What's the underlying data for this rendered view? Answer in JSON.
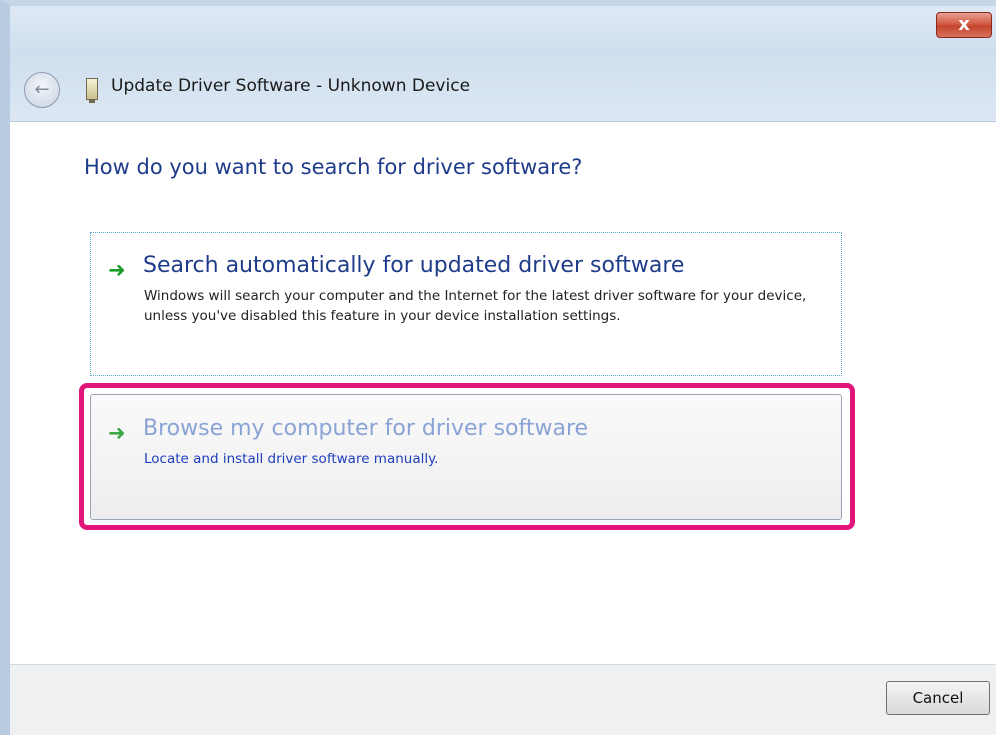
{
  "window": {
    "title": "Update Driver Software - Unknown Device",
    "close_label": "x"
  },
  "main": {
    "question": "How do you want to search for driver software?",
    "options": [
      {
        "title": "Search automatically for updated driver software",
        "description": "Windows will search your computer and the Internet for the latest driver software for your device, unless you've disabled this feature in your device installation settings."
      },
      {
        "title": "Browse my computer for driver software",
        "description": "Locate and install driver software manually."
      }
    ]
  },
  "footer": {
    "cancel_label": "Cancel"
  },
  "colors": {
    "highlight": "#e2157a",
    "heading": "#1f3c8a",
    "arrow": "#1b9d2a"
  },
  "icons": {
    "back": "back-arrow-icon",
    "device": "device-icon",
    "option_arrow": "green-arrow-icon",
    "close": "close-icon"
  }
}
